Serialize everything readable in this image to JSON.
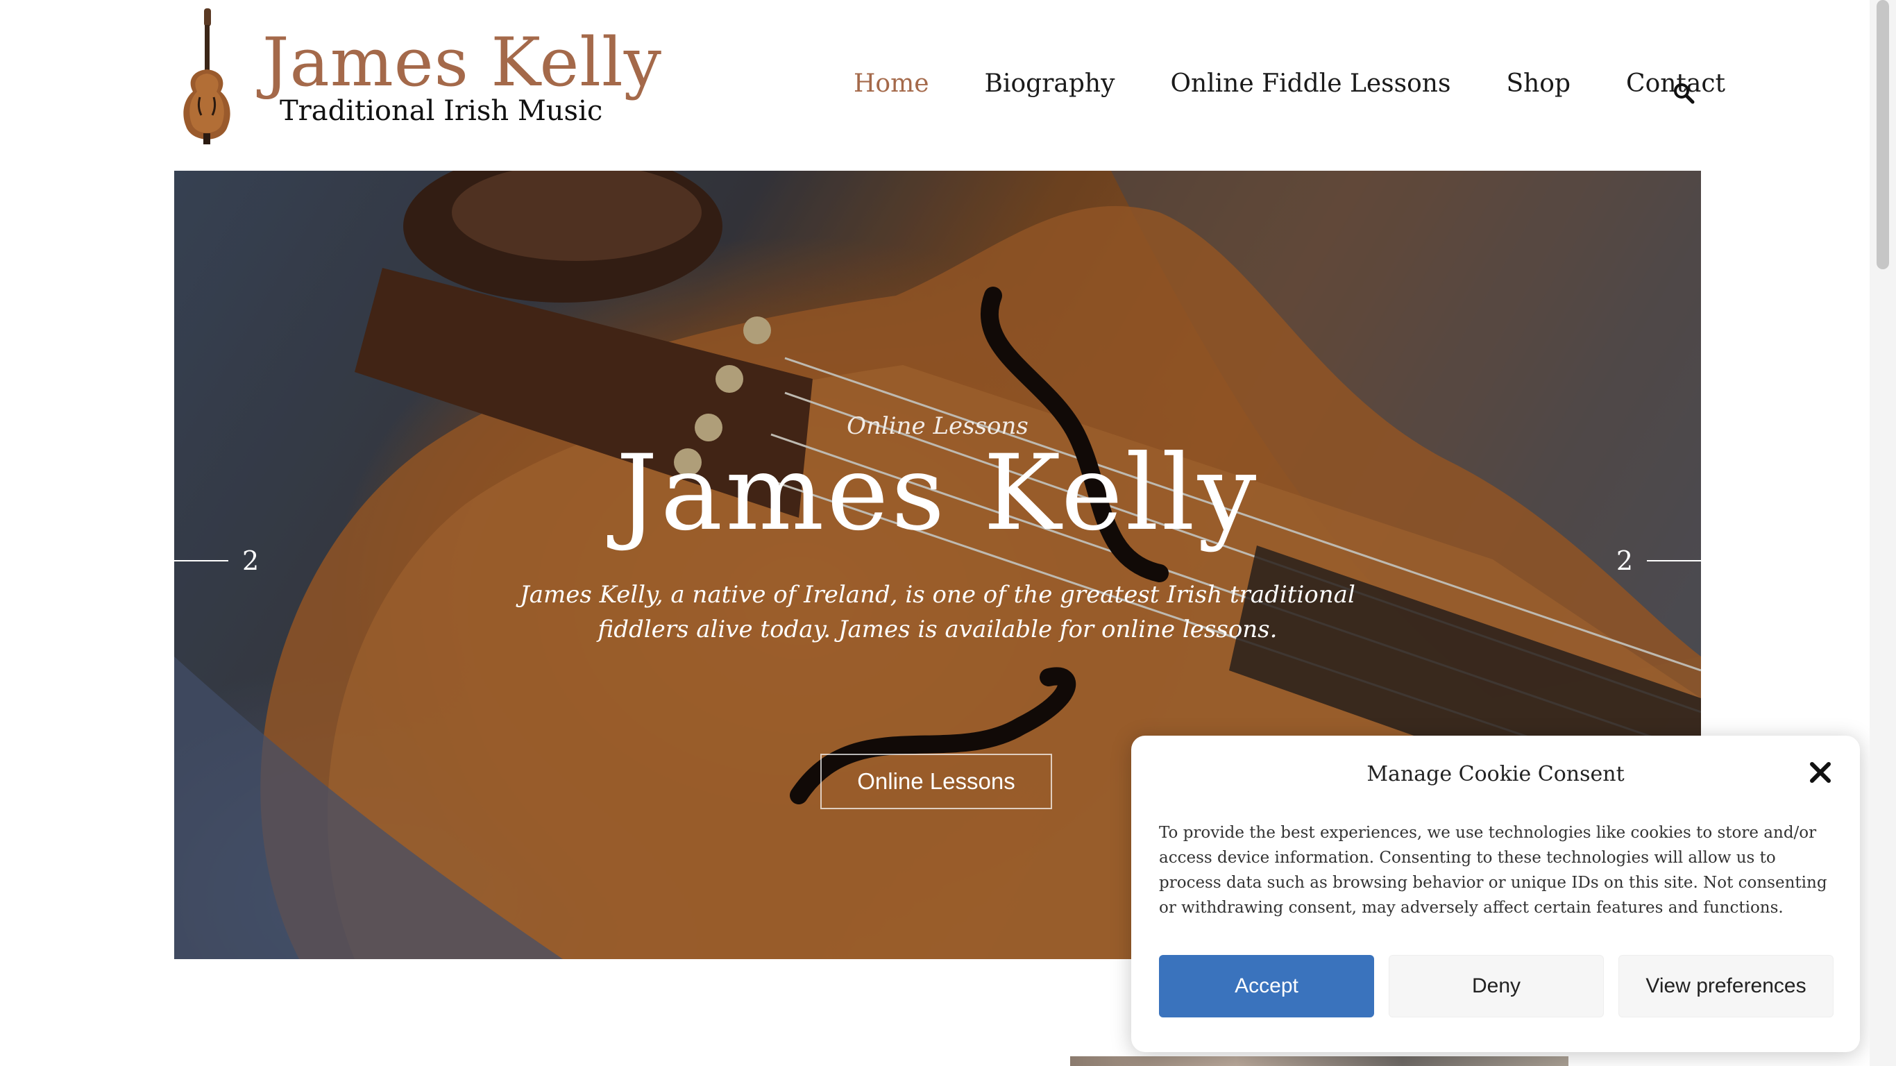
{
  "brand": {
    "title": "James Kelly",
    "subtitle": "Traditional Irish Music",
    "accent_color": "#a4694a"
  },
  "nav": {
    "items": [
      {
        "label": "Home",
        "active": true
      },
      {
        "label": "Biography",
        "active": false
      },
      {
        "label": "Online Fiddle Lessons",
        "active": false
      },
      {
        "label": "Shop",
        "active": false
      },
      {
        "label": "Contact",
        "active": false
      }
    ],
    "search_icon": "search-icon"
  },
  "hero": {
    "eyebrow": "Online Lessons",
    "title": "James Kelly",
    "description": "James Kelly, a native of Ireland, is one of the greatest Irish traditional fiddlers alive today. James is available for online lessons.",
    "button_label": "Online Lessons",
    "prev_number": "2",
    "next_number": "2"
  },
  "cookie": {
    "title": "Manage Cookie Consent",
    "text": "To provide the best experiences, we use technologies like cookies to store and/or access device information. Consenting to these technologies will allow us to process data such as browsing behavior or unique IDs on this site. Not consenting or withdrawing consent, may adversely affect certain features and functions.",
    "accept_label": "Accept",
    "deny_label": "Deny",
    "prefs_label": "View preferences",
    "accept_color": "#3a73bd",
    "close_icon": "close-icon"
  }
}
